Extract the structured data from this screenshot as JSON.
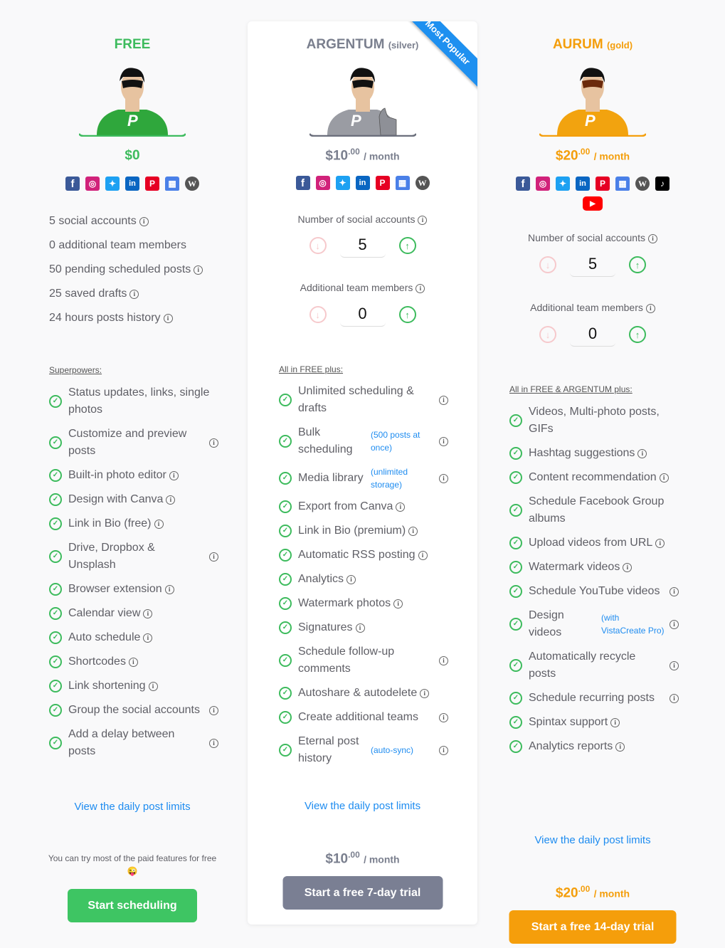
{
  "plans": {
    "free": {
      "title": "FREE",
      "subtitle": "",
      "color": "#3dbb5d",
      "price": "$0",
      "socials": [
        "facebook-icon",
        "instagram-icon",
        "twitter-icon",
        "linkedin-icon",
        "pinterest-icon",
        "google-business-icon",
        "wordpress-icon"
      ],
      "limits": [
        {
          "text": "5 social accounts",
          "info": true
        },
        {
          "text": "0 additional team members",
          "info": false
        },
        {
          "text": "50 pending scheduled posts",
          "info": true
        },
        {
          "text": "25 saved drafts",
          "info": true
        },
        {
          "text": "24 hours posts history",
          "info": true
        }
      ],
      "section_head": "Superpowers:",
      "features": [
        {
          "text": "Status updates, links, single photos",
          "info": false
        },
        {
          "text": "Customize and preview posts",
          "info": true
        },
        {
          "text": "Built-in photo editor",
          "info": true
        },
        {
          "text": "Design with Canva",
          "info": true
        },
        {
          "text": "Link in Bio (free)",
          "info": true
        },
        {
          "text": "Drive, Dropbox & Unsplash",
          "info": true
        },
        {
          "text": "Browser extension",
          "info": true
        },
        {
          "text": "Calendar view",
          "info": true
        },
        {
          "text": "Auto schedule",
          "info": true
        },
        {
          "text": "Shortcodes",
          "info": true
        },
        {
          "text": "Link shortening",
          "info": true
        },
        {
          "text": "Group the social accounts",
          "info": true
        },
        {
          "text": "Add a delay between posts",
          "info": true
        }
      ],
      "limits_link": "View the daily post limits",
      "try_text": "You can try most of the paid features for free 😜",
      "cta": "Start scheduling"
    },
    "silver": {
      "badge": "Most Popular",
      "title": "ARGENTUM",
      "subtitle": "(silver)",
      "color": "#7a7f8e",
      "price_main": "$10",
      "price_cents": ".00",
      "price_period": "/ month",
      "socials": [
        "facebook-icon",
        "instagram-icon",
        "twitter-icon",
        "linkedin-icon",
        "pinterest-icon",
        "google-business-icon",
        "wordpress-icon"
      ],
      "social_accounts_label": "Number of social accounts",
      "social_accounts_value": "5",
      "team_members_label": "Additional team members",
      "team_members_value": "0",
      "section_head": "All in FREE plus:",
      "features": [
        {
          "text": "Unlimited scheduling & drafts",
          "note": "",
          "info": true
        },
        {
          "text": "Bulk scheduling",
          "note": "(500 posts at once)",
          "info": true
        },
        {
          "text": "Media library",
          "note": "(unlimited storage)",
          "info": true
        },
        {
          "text": "Export from Canva",
          "note": "",
          "info": true
        },
        {
          "text": "Link in Bio (premium)",
          "note": "",
          "info": true
        },
        {
          "text": "Automatic RSS posting",
          "note": "",
          "info": true
        },
        {
          "text": "Analytics",
          "note": "",
          "info": true
        },
        {
          "text": "Watermark photos",
          "note": "",
          "info": true
        },
        {
          "text": "Signatures",
          "note": "",
          "info": true
        },
        {
          "text": "Schedule follow-up comments",
          "note": "",
          "info": true
        },
        {
          "text": "Autoshare & autodelete",
          "note": "",
          "info": true
        },
        {
          "text": "Create additional teams",
          "note": "",
          "info": true
        },
        {
          "text": "Eternal post history",
          "note": "(auto-sync)",
          "info": true
        }
      ],
      "limits_link": "View the daily post limits",
      "cta": "Start a free 7-day trial"
    },
    "gold": {
      "title": "AURUM",
      "subtitle": "(gold)",
      "color": "#f49e0b",
      "price_main": "$20",
      "price_cents": ".00",
      "price_period": "/ month",
      "socials": [
        "facebook-icon",
        "instagram-icon",
        "twitter-icon",
        "linkedin-icon",
        "pinterest-icon",
        "google-business-icon",
        "wordpress-icon",
        "tiktok-icon",
        "youtube-icon"
      ],
      "social_accounts_label": "Number of social accounts",
      "social_accounts_value": "5",
      "team_members_label": "Additional team members",
      "team_members_value": "0",
      "section_head": "All in FREE & ARGENTUM plus:",
      "features": [
        {
          "text": "Videos, Multi-photo posts, GIFs",
          "note": "",
          "info": false
        },
        {
          "text": "Hashtag suggestions",
          "note": "",
          "info": true
        },
        {
          "text": "Content recommendation",
          "note": "",
          "info": true
        },
        {
          "text": "Schedule Facebook Group albums",
          "note": "",
          "info": false
        },
        {
          "text": "Upload videos from URL",
          "note": "",
          "info": true
        },
        {
          "text": "Watermark videos",
          "note": "",
          "info": true
        },
        {
          "text": "Schedule YouTube videos",
          "note": "",
          "info": true
        },
        {
          "text": "Design videos",
          "note": "(with VistaCreate Pro)",
          "info": true
        },
        {
          "text": "Automatically recycle posts",
          "note": "",
          "info": true
        },
        {
          "text": "Schedule recurring posts",
          "note": "",
          "info": true
        },
        {
          "text": "Spintax support",
          "note": "",
          "info": true
        },
        {
          "text": "Analytics reports",
          "note": "",
          "info": true
        }
      ],
      "limits_link": "View the daily post limits",
      "cta": "Start a free 14-day trial"
    }
  },
  "icons": {
    "facebook-icon": "f",
    "instagram-icon": "◎",
    "twitter-icon": "✦",
    "linkedin-icon": "in",
    "pinterest-icon": "P",
    "google-business-icon": "▦",
    "wordpress-icon": "W",
    "tiktok-icon": "♪",
    "youtube-icon": "▶",
    "check-icon": "✓",
    "info-icon": "i",
    "arrow-down-icon": "↓",
    "arrow-up-icon": "↑"
  }
}
